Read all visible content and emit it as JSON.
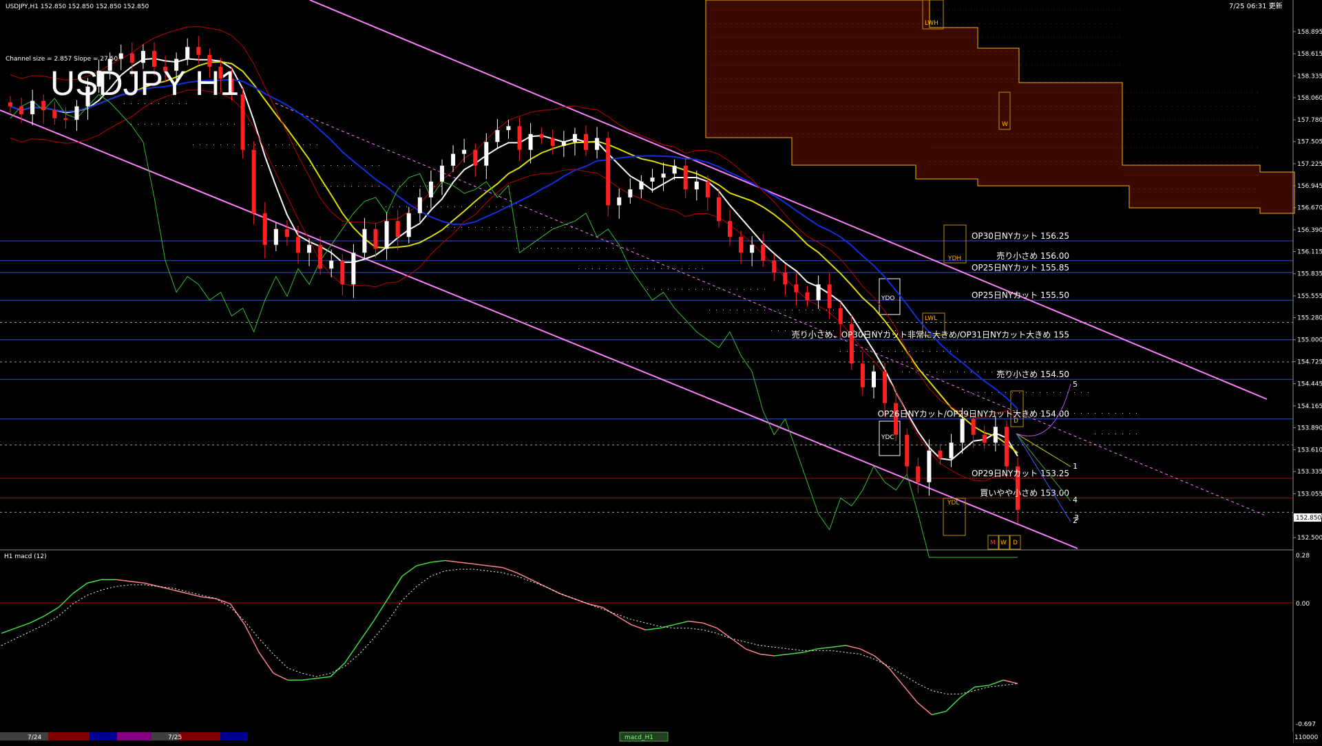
{
  "header": {
    "symbol_info": "USDJPY,H1  152.850 152.850 152.850 152.850",
    "datetime": "7/25 06:31 更新"
  },
  "main": {
    "title": "USDJPY H1",
    "indicator_note": "Channel size = 2.857 Slope = 27.50",
    "current_price": "152.850"
  },
  "levels": [
    {
      "text": "OP30日NYカット 156.25",
      "price": 156.25,
      "color": "#3050d0"
    },
    {
      "text": "売り小さめ 156.00",
      "price": 156.0,
      "color": "#3050d0"
    },
    {
      "text": "OP25日NYカット 155.85",
      "price": 155.85,
      "color": "#3050d0"
    },
    {
      "text": "OP25日NYカット 155.50",
      "price": 155.5,
      "color": "#3050d0"
    },
    {
      "text": "売り小さめ、OP30日NYカット非常に大きめ/OP31日NYカット大きめ 155",
      "price": 155.0,
      "color": "#3050d0"
    },
    {
      "text": "売り小さめ 154.50",
      "price": 154.5,
      "color": "#3050d0"
    },
    {
      "text": "OP26日NYカット/OP29日NYカット大きめ 154.00",
      "price": 154.0,
      "color": "#3050d0"
    },
    {
      "text": "OP29日NYカット 153.25",
      "price": 153.25,
      "color": "#c00000"
    },
    {
      "text": "買いやや小さめ 153.00",
      "price": 153.0,
      "color": "#c00000"
    }
  ],
  "boxes": {
    "ydh": "YDH",
    "ydo": "YDO",
    "ydc": "YDC",
    "ydl": "YDL",
    "lwh": "LWH",
    "lwl": "LWL",
    "w": "W",
    "m": "M",
    "w2": "W",
    "d": "D",
    "d2": "D"
  },
  "projections": [
    "1",
    "4",
    "2",
    "3",
    "5"
  ],
  "y_axis_ticks": [
    "158.895",
    "158.615",
    "158.335",
    "158.060",
    "157.780",
    "157.505",
    "157.225",
    "156.945",
    "156.670",
    "156.390",
    "156.115",
    "155.835",
    "155.555",
    "155.280",
    "155.000",
    "154.725",
    "154.445",
    "154.165",
    "153.890",
    "153.610",
    "153.335",
    "153.055",
    "152.775",
    "152.500"
  ],
  "macd": {
    "label": "H1  macd (12)",
    "axis_top": "0.28",
    "axis_zero": "0.00",
    "axis_bottom": "-0.697"
  },
  "bottom_bar": {
    "date1": "7/24",
    "date2": "7/25",
    "tab_label": "macd_H1",
    "right_value": "110000"
  },
  "chart_data": [
    {
      "type": "candlestick",
      "title": "USDJPY H1",
      "ylim": [
        152.38,
        159.12
      ],
      "series": [
        {
          "name": "closes",
          "values": [
            157.95,
            157.85,
            158.02,
            157.9,
            157.8,
            157.78,
            157.95,
            158.2,
            158.4,
            158.55,
            158.62,
            158.5,
            158.65,
            158.45,
            158.4,
            158.55,
            158.7,
            158.6,
            158.45,
            158.3,
            158.1,
            157.4,
            156.6,
            156.2,
            156.4,
            156.3,
            156.1,
            156.2,
            155.9,
            156.0,
            155.7,
            156.1,
            156.4,
            156.15,
            156.5,
            156.3,
            156.6,
            156.8,
            157.0,
            157.2,
            157.35,
            157.4,
            157.2,
            157.5,
            157.65,
            157.7,
            157.4,
            157.6,
            157.55,
            157.45,
            157.5,
            157.6,
            157.4,
            157.55,
            156.7,
            156.8,
            156.9,
            157.0,
            157.05,
            157.1,
            157.2,
            156.9,
            157.0,
            156.8,
            156.5,
            156.3,
            156.1,
            156.2,
            156.0,
            155.85,
            155.7,
            155.6,
            155.5,
            155.7,
            155.4,
            155.2,
            154.7,
            154.4,
            154.6,
            154.2,
            153.8,
            153.4,
            153.2,
            153.6,
            153.5,
            153.7,
            154.0,
            153.8,
            153.7,
            153.9,
            153.4,
            152.85
          ]
        }
      ]
    },
    {
      "type": "line",
      "title": "H1 macd (12)",
      "ylim": [
        -0.697,
        0.28
      ],
      "series": [
        {
          "name": "macd",
          "values": [
            -0.15,
            -0.12,
            -0.09,
            -0.05,
            0.0,
            0.08,
            0.14,
            0.16,
            0.16,
            0.15,
            0.14,
            0.12,
            0.1,
            0.08,
            0.06,
            0.05,
            0.02,
            -0.1,
            -0.26,
            -0.38,
            -0.42,
            -0.42,
            -0.41,
            -0.4,
            -0.32,
            -0.2,
            -0.08,
            0.05,
            0.18,
            0.24,
            0.26,
            0.27,
            0.26,
            0.25,
            0.24,
            0.23,
            0.2,
            0.16,
            0.12,
            0.08,
            0.05,
            0.02,
            0.0,
            -0.05,
            -0.1,
            -0.13,
            -0.12,
            -0.1,
            -0.08,
            -0.09,
            -0.12,
            -0.18,
            -0.24,
            -0.27,
            -0.28,
            -0.27,
            -0.26,
            -0.24,
            -0.23,
            -0.22,
            -0.24,
            -0.28,
            -0.35,
            -0.45,
            -0.55,
            -0.62,
            -0.6,
            -0.52,
            -0.46,
            -0.45,
            -0.42,
            -0.44
          ]
        },
        {
          "name": "signal",
          "values": [
            -0.22,
            -0.18,
            -0.14,
            -0.1,
            -0.05,
            0.02,
            0.07,
            0.1,
            0.12,
            0.13,
            0.13,
            0.12,
            0.11,
            0.09,
            0.07,
            0.05,
            0.0,
            -0.08,
            -0.18,
            -0.27,
            -0.35,
            -0.38,
            -0.4,
            -0.38,
            -0.34,
            -0.27,
            -0.18,
            -0.08,
            0.04,
            0.12,
            0.18,
            0.21,
            0.22,
            0.22,
            0.21,
            0.2,
            0.18,
            0.15,
            0.12,
            0.08,
            0.05,
            0.02,
            -0.01,
            -0.04,
            -0.07,
            -0.09,
            -0.11,
            -0.12,
            -0.12,
            -0.13,
            -0.15,
            -0.18,
            -0.2,
            -0.22,
            -0.23,
            -0.24,
            -0.25,
            -0.25,
            -0.25,
            -0.26,
            -0.27,
            -0.3,
            -0.34,
            -0.39,
            -0.44,
            -0.48,
            -0.5,
            -0.5,
            -0.48,
            -0.46,
            -0.45,
            -0.44
          ]
        }
      ]
    }
  ]
}
